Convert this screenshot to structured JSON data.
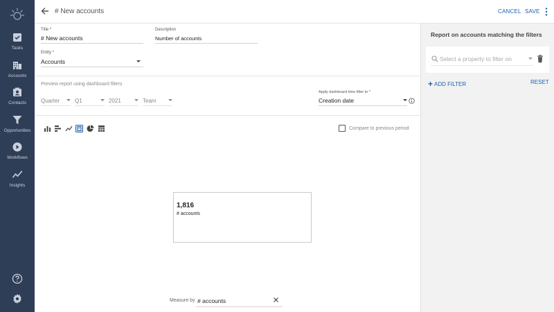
{
  "nav": {
    "items": [
      {
        "label": "Tasks",
        "icon": "tasks-icon"
      },
      {
        "label": "Accounts",
        "icon": "accounts-icon"
      },
      {
        "label": "Contacts",
        "icon": "contacts-icon"
      },
      {
        "label": "Opportunities",
        "icon": "opportunities-icon"
      },
      {
        "label": "Workflows",
        "icon": "workflows-icon"
      },
      {
        "label": "Insights",
        "icon": "insights-icon"
      }
    ],
    "bottom_icons": [
      "help-icon",
      "settings-icon"
    ],
    "background": "#2f3e57"
  },
  "header": {
    "title": "# New accounts",
    "cancel_label": "CANCEL",
    "save_label": "SAVE"
  },
  "form": {
    "title_label": "Title *",
    "title_value": "# New accounts",
    "description_label": "Description",
    "description_value": "Number of accounts",
    "entity_label": "Entity *",
    "entity_value": "Accounts"
  },
  "preview": {
    "label": "Preview report using dashboard filters",
    "period": "Quarter",
    "quarter": "Q1",
    "year": "2021",
    "team": "Team",
    "time_filter_label": "Apply dashboard time filter to *",
    "time_filter_value": "Creation date"
  },
  "toolbar": {
    "chart_types": [
      "bar-chart-icon",
      "horizontal-bar-icon",
      "line-chart-icon",
      "number-card-icon",
      "pie-chart-icon",
      "table-icon"
    ],
    "selected": "number-card-icon",
    "compare_label": "Compare to previous period",
    "compare_checked": false
  },
  "card": {
    "value": "1,816",
    "label": "# accounts"
  },
  "measure": {
    "label": "Measure by",
    "value": "# accounts"
  },
  "right_panel": {
    "title": "Report on accounts matching the filters",
    "placeholder": "Select a property to filter on",
    "add_filter_label": "ADD FILTER",
    "reset_label": "RESET"
  },
  "colors": {
    "accent": "#1f5fa8",
    "sidebar": "#2f3e57"
  }
}
